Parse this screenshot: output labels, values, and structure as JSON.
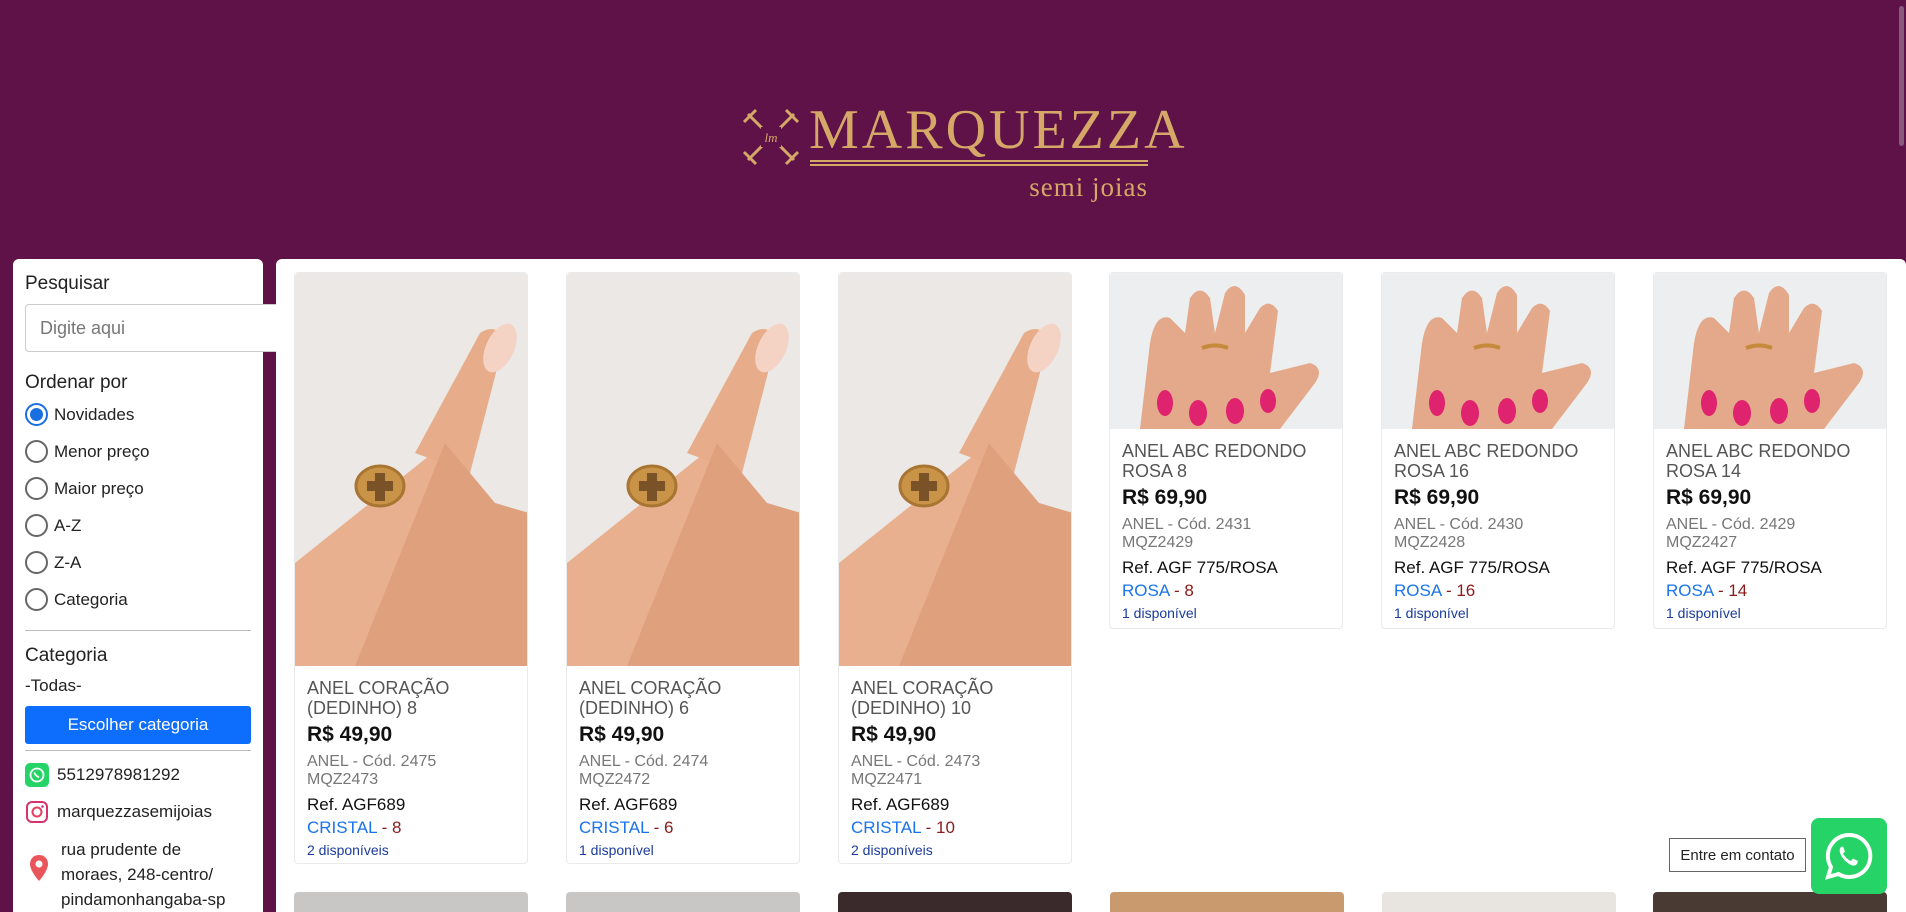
{
  "brand": {
    "name": "MARQUEZZA",
    "tagline": "semi joias"
  },
  "sidebar": {
    "search_title": "Pesquisar",
    "search_placeholder": "Digite aqui",
    "sort_title": "Ordenar por",
    "sort_options": [
      {
        "label": "Novidades",
        "checked": true
      },
      {
        "label": "Menor preço",
        "checked": false
      },
      {
        "label": "Maior preço",
        "checked": false
      },
      {
        "label": "A-Z",
        "checked": false
      },
      {
        "label": "Z-A",
        "checked": false
      },
      {
        "label": "Categoria",
        "checked": false
      }
    ],
    "category_title": "Categoria",
    "category_value": "-Todas-",
    "category_button": "Escolher categoria",
    "phone": "5512978981292",
    "instagram": "marquezzasemijoias",
    "address": [
      "rua prudente de",
      "moraes, 248-centro/",
      "pindamonhangaba-sp"
    ]
  },
  "products": [
    {
      "name": "ANEL CORAÇÃO (DEDINHO) 8",
      "price": "R$ 49,90",
      "cod_line1": "ANEL - Cód. 2475",
      "cod_line2": "MQZ2473",
      "ref": "Ref. AGF689",
      "color": "CRISTAL",
      "size": " - 8",
      "stock": "2 disponíveis",
      "image": "hand-ring-cross"
    },
    {
      "name": "ANEL CORAÇÃO (DEDINHO) 6",
      "price": "R$ 49,90",
      "cod_line1": "ANEL - Cód. 2474",
      "cod_line2": "MQZ2472",
      "ref": "Ref. AGF689",
      "color": "CRISTAL",
      "size": " - 6",
      "stock": "1 disponível",
      "image": "hand-ring-cross"
    },
    {
      "name": "ANEL CORAÇÃO (DEDINHO) 10",
      "price": "R$ 49,90",
      "cod_line1": "ANEL - Cód. 2473",
      "cod_line2": "MQZ2471",
      "ref": "Ref. AGF689",
      "color": "CRISTAL",
      "size": " - 10",
      "stock": "2 disponíveis",
      "image": "hand-ring-cross"
    },
    {
      "name": "ANEL ABC REDONDO ROSA 8",
      "price": "R$ 69,90",
      "cod_line1": "ANEL - Cód. 2431",
      "cod_line2": "MQZ2429",
      "ref": "Ref. AGF 775/ROSA",
      "color": "ROSA",
      "size": " - 8",
      "stock": "1 disponível",
      "image": "hand-pink-nails"
    },
    {
      "name": "ANEL ABC REDONDO ROSA 16",
      "price": "R$ 69,90",
      "cod_line1": "ANEL - Cód. 2430",
      "cod_line2": "MQZ2428",
      "ref": "Ref. AGF 775/ROSA",
      "color": "ROSA",
      "size": " - 16",
      "stock": "1 disponível",
      "image": "hand-pink-nails"
    },
    {
      "name": "ANEL ABC REDONDO ROSA 14",
      "price": "R$ 69,90",
      "cod_line1": "ANEL - Cód. 2429",
      "cod_line2": "MQZ2427",
      "ref": "Ref. AGF 775/ROSA",
      "color": "ROSA",
      "size": " - 14",
      "stock": "1 disponível",
      "image": "hand-pink-nails"
    }
  ],
  "contact_label": "Entre em contato",
  "colors": {
    "brand_bg": "#5e1248",
    "gold": "#d6a867",
    "accent_blue": "#0d6efd",
    "whatsapp": "#25d366"
  }
}
